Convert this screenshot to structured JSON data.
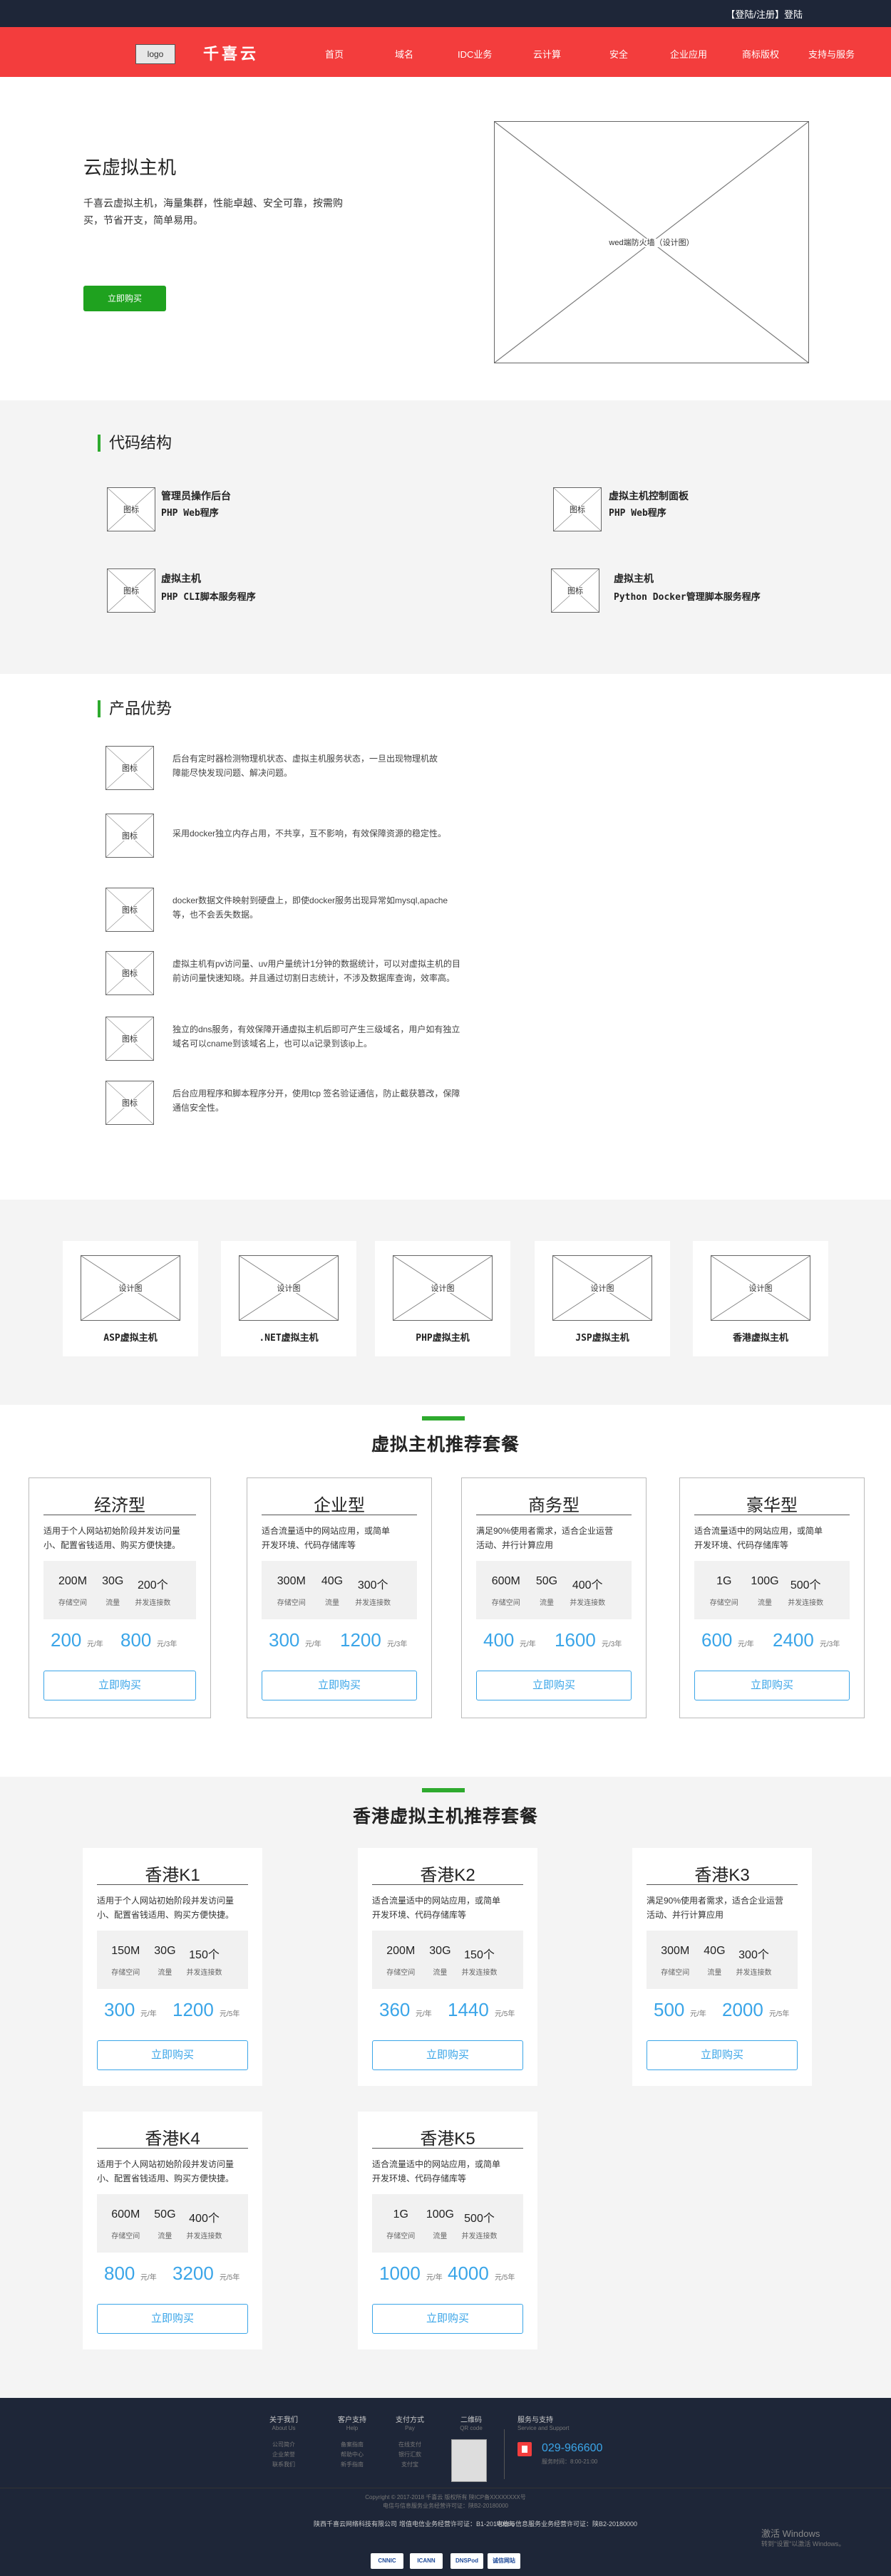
{
  "topbar": {
    "login": "【登陆/注册】登陆"
  },
  "nav": {
    "logo": "logo",
    "brand": "千喜云",
    "items": [
      "首页",
      "域名",
      "IDC业务",
      "云计算",
      "安全",
      "企业应用",
      "商标版权",
      "支持与服务"
    ]
  },
  "hero": {
    "title": "云虚拟主机",
    "desc_line1": "千喜云虚拟主机，海量集群，性能卓越、安全可靠，按需购",
    "desc_line2": "买，节省开支，简单易用。",
    "button": "立即购买",
    "image_label": "wed端防火墙（设计图）"
  },
  "code_structure": {
    "title": "代码结构",
    "icon_label": "图标",
    "items": [
      {
        "name": "管理员操作后台",
        "sub": "PHP Web程序"
      },
      {
        "name": "虚拟主机控制面板",
        "sub": "PHP Web程序"
      },
      {
        "name": "虚拟主机",
        "sub": "PHP CLI脚本服务程序"
      },
      {
        "name": "虚拟主机",
        "sub": "Python Docker管理脚本服务程序"
      }
    ]
  },
  "advantages": {
    "title": "产品优势",
    "icon_label": "图标",
    "items": [
      [
        "后台有定时器检测物理机状态、虚拟主机服务状态，一旦出现物理机故",
        "障能尽快发现问题、解决问题。"
      ],
      [
        "采用docker独立内存占用，不共享，互不影响，有效保障资源的稳定性。"
      ],
      [
        "docker数据文件映射到硬盘上，即使docker服务出现异常如mysql,apache",
        "等，也不会丢失数据。"
      ],
      [
        "虚拟主机有pv访问量、uv用户量统计1分钟的数据统计，可以对虚拟主机的目",
        "前访问量快速知晓。并且通过切割日志统计，不涉及数据库查询，效率高。"
      ],
      [
        "独立的dns服务，有效保障开通虚拟主机后即可产生三级域名，用户如有独立",
        "域名可以cname到该域名上，也可以a记录到该ip上。"
      ],
      [
        "后台应用程序和脚本程序分开，使用tcp 签名验证通信，防止截获篡改，保障",
        "通信安全性。"
      ]
    ]
  },
  "products": {
    "image_label": "设计图",
    "items": [
      "ASP虚拟主机",
      ".NET虚拟主机",
      "PHP虚拟主机",
      "JSP虚拟主机",
      "香港虚拟主机"
    ]
  },
  "packages": {
    "title": "虚拟主机推荐套餐",
    "price_unit1": "元/年",
    "price_unit2": "元/3年",
    "spec_labels": [
      "存储空间",
      "流量",
      "并发连接数"
    ],
    "button": "立即购买",
    "items": [
      {
        "name": "经济型",
        "desc": [
          "适用于个人网站初始阶段并发访问量",
          "小、配置省钱适用、购买方便快捷。"
        ],
        "specs": [
          "200M",
          "30G",
          "200个"
        ],
        "price1": "200",
        "price2": "800"
      },
      {
        "name": "企业型",
        "desc": [
          "适合流量适中的网站应用，或简单",
          "开发环境、代码存储库等"
        ],
        "specs": [
          "300M",
          "40G",
          "300个"
        ],
        "price1": "300",
        "price2": "1200"
      },
      {
        "name": "商务型",
        "desc": [
          "满足90%使用者需求，适合企业运营",
          "活动、并行计算应用"
        ],
        "specs": [
          "600M",
          "50G",
          "400个"
        ],
        "price1": "400",
        "price2": "1600"
      },
      {
        "name": "豪华型",
        "desc": [
          "适合流量适中的网站应用，或简单",
          "开发环境、代码存储库等"
        ],
        "specs": [
          "1G",
          "100G",
          "500个"
        ],
        "price1": "600",
        "price2": "2400"
      }
    ]
  },
  "hk_packages": {
    "title": "香港虚拟主机推荐套餐",
    "price_unit1": "元/年",
    "price_unit2": "元/5年",
    "spec_labels": [
      "存储空间",
      "流量",
      "并发连接数"
    ],
    "button": "立即购买",
    "items": [
      {
        "name": "香港K1",
        "desc": [
          "适用于个人网站初始阶段并发访问量",
          "小、配置省钱适用、购买方便快捷。"
        ],
        "specs": [
          "150M",
          "30G",
          "150个"
        ],
        "price1": "300",
        "price2": "1200"
      },
      {
        "name": "香港K2",
        "desc": [
          "适合流量适中的网站应用，或简单",
          "开发环境、代码存储库等"
        ],
        "specs": [
          "200M",
          "30G",
          "150个"
        ],
        "price1": "360",
        "price2": "1440"
      },
      {
        "name": "香港K3",
        "desc": [
          "满足90%使用者需求，适合企业运营",
          "活动、并行计算应用"
        ],
        "specs": [
          "300M",
          "40G",
          "300个"
        ],
        "price1": "500",
        "price2": "2000"
      },
      {
        "name": "香港K4",
        "desc": [
          "适用于个人网站初始阶段并发访问量",
          "小、配置省钱适用、购买方便快捷。"
        ],
        "specs": [
          "600M",
          "50G",
          "400个"
        ],
        "price1": "800",
        "price2": "3200"
      },
      {
        "name": "香港K5",
        "desc": [
          "适合流量适中的网站应用，或简单",
          "开发环境、代码存储库等"
        ],
        "specs": [
          "1G",
          "100G",
          "500个"
        ],
        "price1": "1000",
        "price2": "4000"
      }
    ]
  },
  "footer": {
    "cols": [
      {
        "title": "关于我们",
        "sub": "About Us",
        "links": [
          "公司简介",
          "企业荣誉",
          "联系我们"
        ]
      },
      {
        "title": "客户支持",
        "sub": "Help",
        "links": [
          "备案指南",
          "帮助中心",
          "新手指南"
        ]
      },
      {
        "title": "支付方式",
        "sub": "Pay",
        "links": [
          "在线支付",
          "银行汇款",
          "支付宝"
        ]
      },
      {
        "title": "二维码",
        "sub": "QR code",
        "links": []
      }
    ],
    "service": {
      "title": "服务与支持",
      "sub": "Service and Support",
      "phone": "029-966600",
      "hours": "服务时间：8:00-21:00"
    },
    "copyright": "Copyright © 2017-2018 千喜云 版权所有 陕ICP备XXXXXXXX号",
    "license": "增值电信业务经营许可证：B1-20170666",
    "license2": "电信与信息服务业务经营许可证：陕B2-20180000",
    "brand_line": "陕西千喜云网络科技有限公司",
    "watermark_title": "激活 Windows",
    "watermark_sub": "转到\"设置\"以激活 Windows。",
    "badges": [
      "CNNIC",
      "ICANN",
      "DNSPod",
      "诚信网站"
    ]
  }
}
